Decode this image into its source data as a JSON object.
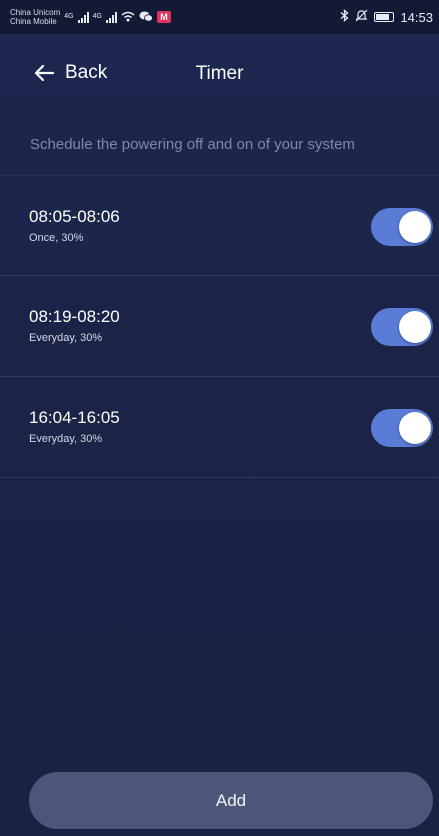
{
  "status_bar": {
    "carrier_1": "China Unicom",
    "carrier_2": "China Mobile",
    "net_1": "4G",
    "net_2": "4G",
    "mail_badge": "M",
    "time": "14:53"
  },
  "header": {
    "back_label": "Back",
    "title": "Timer"
  },
  "description": "Schedule the powering off and on of your system",
  "timers": [
    {
      "time": "08:05-08:06",
      "detail": "Once, 30%",
      "enabled": true
    },
    {
      "time": "08:19-08:20",
      "detail": "Everyday, 30%",
      "enabled": true
    },
    {
      "time": "16:04-16:05",
      "detail": "Everyday, 30%",
      "enabled": true
    }
  ],
  "add_button_label": "Add",
  "colors": {
    "background": "#1c2548",
    "toggle_on": "#5a7cd6",
    "add_button": "#4c5679",
    "description_text": "#7d87b0"
  }
}
